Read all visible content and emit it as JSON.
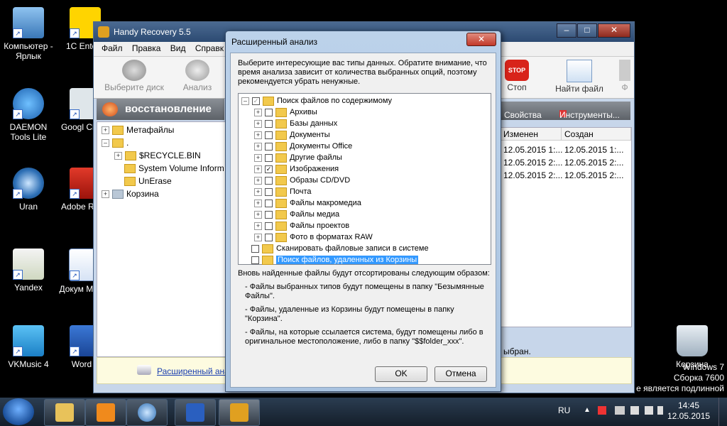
{
  "desktop": {
    "icons": [
      {
        "label": "Компьютер - Ярлык"
      },
      {
        "label": "1C Enterp"
      },
      {
        "label": "DAEMON Tools Lite"
      },
      {
        "label": "Googl Chron"
      },
      {
        "label": "Uran"
      },
      {
        "label": "Adobe Re XI"
      },
      {
        "label": "Yandex"
      },
      {
        "label": "Докум Micros"
      },
      {
        "label": "VKMusic 4"
      },
      {
        "label": "Word 2"
      },
      {
        "label": "Корзина"
      }
    ],
    "watermark_line1": "Windows 7",
    "watermark_line2": "Сборка 7600",
    "watermark_line3": "е является подлинной"
  },
  "main_window": {
    "title": "Handy Recovery 5.5",
    "menu": [
      "Файл",
      "Правка",
      "Вид",
      "Справк"
    ],
    "toolbar": {
      "select_disk": "Выберите диск",
      "analyze": "Анализ",
      "stop": "Стоп",
      "find_file": "Найти файл",
      "extra": "Ф"
    },
    "section_title": "восстановление",
    "tree": [
      {
        "label": "Метафайлы"
      },
      {
        "label": "."
      },
      {
        "label": "$RECYCLE.BIN"
      },
      {
        "label": "System Volume Inform"
      },
      {
        "label": "UnErase"
      },
      {
        "label": "Корзина"
      }
    ],
    "right_toolbar": {
      "properties": "Свойства",
      "tools": "Инструменты..."
    },
    "columns": [
      "Изменен",
      "Создан"
    ],
    "rows": [
      [
        "12.05.2015 1:...",
        "12.05.2015 1:..."
      ],
      [
        "12.05.2015 2:...",
        "12.05.2015 2:..."
      ],
      [
        "12.05.2015 2:...",
        "12.05.2015 2:..."
      ]
    ],
    "status_tail": "ыбран.",
    "advanced_link": "Расширенный ана"
  },
  "dialog": {
    "title": "Расширенный анализ",
    "close": "✕",
    "description": "Выберите интересующие вас типы данных. Обратите внимание, что время анализа зависит от количества выбранных опций, поэтому рекомендуется убрать ненужные.",
    "tree": {
      "root": "Поиск файлов по содержимому",
      "children": [
        {
          "label": "Архивы",
          "checked": false
        },
        {
          "label": "Базы данных",
          "checked": false
        },
        {
          "label": "Документы",
          "checked": false
        },
        {
          "label": "Документы Office",
          "checked": false
        },
        {
          "label": "Другие файлы",
          "checked": false
        },
        {
          "label": "Изображения",
          "checked": true
        },
        {
          "label": "Образы CD/DVD",
          "checked": false
        },
        {
          "label": "Почта",
          "checked": false
        },
        {
          "label": "Файлы макромедиа",
          "checked": false
        },
        {
          "label": "Файлы медиа",
          "checked": false
        },
        {
          "label": "Файлы проектов",
          "checked": false
        },
        {
          "label": "Фото в форматах RAW",
          "checked": false
        }
      ],
      "scan_system": "Сканировать файловые записи в системе",
      "recycle_search": "Поиск файлов, удаленных из Корзины"
    },
    "notes_intro": "Вновь найденные файлы будут отсортированы следующим образом:",
    "note1": "- Файлы выбранных типов будут помещены в папку \"Безымянные Файлы\".",
    "note2": "- Файлы, удаленные из Корзины будут помещены в папку \"Корзина\".",
    "note3": "- Файлы, на которые ссылается система, будут помещены либо в оригинальное местоположение, либо в папку \"$$folder_xxx\".",
    "ok": "OK",
    "cancel": "Отмена"
  },
  "taskbar": {
    "lang": "RU",
    "time": "14:45",
    "date": "12.05.2015"
  }
}
